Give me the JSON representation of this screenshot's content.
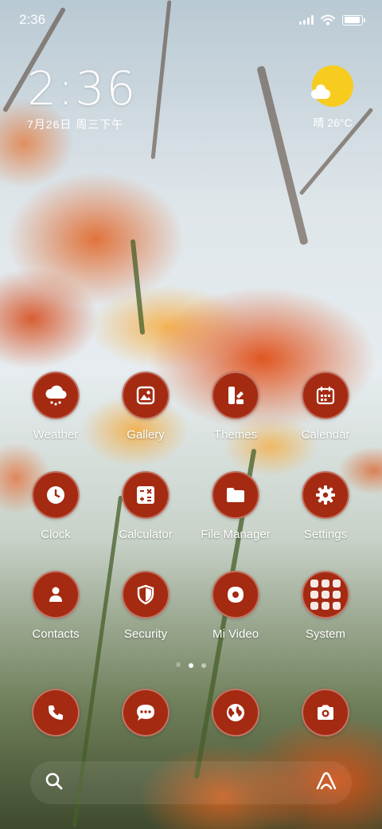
{
  "status_bar": {
    "time": "2:36",
    "battery_level": 0.95
  },
  "clock_widget": {
    "time": "2:36",
    "date": "7月26日 周三下午"
  },
  "weather_widget": {
    "condition_icon": "sun-cloud-icon",
    "text": "晴 26°C"
  },
  "apps": {
    "weather": {
      "label": "Weather",
      "icon": "weather-icon"
    },
    "gallery": {
      "label": "Gallery",
      "icon": "gallery-icon"
    },
    "themes": {
      "label": "Themes",
      "icon": "themes-icon"
    },
    "calendar": {
      "label": "Calendar",
      "icon": "calendar-icon"
    },
    "clock": {
      "label": "Clock",
      "icon": "clock-icon"
    },
    "calculator": {
      "label": "Calculator",
      "icon": "calculator-icon"
    },
    "file_manager": {
      "label": "File Manager",
      "icon": "folder-icon"
    },
    "settings": {
      "label": "Settings",
      "icon": "gear-icon"
    },
    "contacts": {
      "label": "Contacts",
      "icon": "contact-icon"
    },
    "security": {
      "label": "Security",
      "icon": "shield-icon"
    },
    "mi_video": {
      "label": "Mi Video",
      "icon": "video-icon"
    },
    "system": {
      "label": "System",
      "icon": "folder-grid-icon"
    }
  },
  "dock": {
    "phone": {
      "icon": "phone-icon"
    },
    "messages": {
      "icon": "message-icon"
    },
    "browser": {
      "icon": "globe-icon"
    },
    "camera": {
      "icon": "camera-icon"
    }
  },
  "page_indicator": {
    "pages": 2,
    "current_page": 1
  },
  "search_bar": {
    "left_icon": "search-icon",
    "right_icon": "assistant-icon"
  },
  "colors": {
    "icon_background": "#a42a12",
    "weather_sun": "#f7cc1f"
  }
}
